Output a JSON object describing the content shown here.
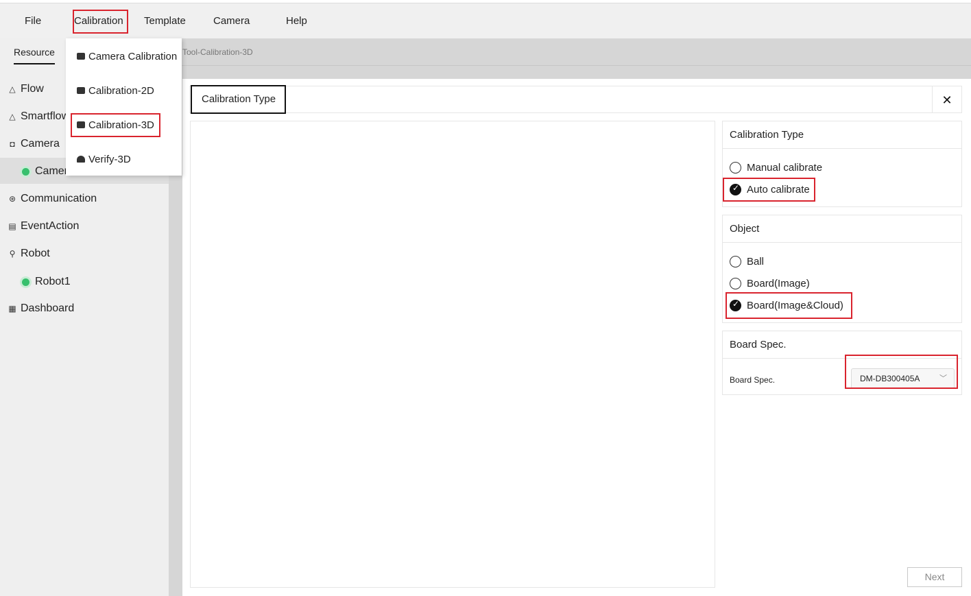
{
  "menubar": {
    "items": [
      "File",
      "Calibration",
      "Template",
      "Camera",
      "Help"
    ]
  },
  "calibration_menu": {
    "items": [
      "Camera Calibration",
      "Calibration-2D",
      "Calibration-3D",
      "Verify-3D"
    ]
  },
  "sidebar": {
    "tab": "Resource",
    "items": {
      "flow": "Flow",
      "smartflow": "Smartflow",
      "camera": "Camera",
      "camera_child": "Camera1",
      "communication": "Communication",
      "eventaction": "EventAction",
      "robot": "Robot",
      "robot_child": "Robot1",
      "dashboard": "Dashboard"
    }
  },
  "tabstrip": {
    "active_tab": "Tool-Calibration-3D"
  },
  "dialog": {
    "title": "Calibration Type",
    "close_glyph": "✕",
    "calibration_type": {
      "title": "Calibration Type",
      "options": [
        "Manual calibrate",
        "Auto calibrate"
      ],
      "selected": "Auto calibrate"
    },
    "object": {
      "title": "Object",
      "options": [
        "Ball",
        "Board(Image)",
        "Board(Image&Cloud)"
      ],
      "selected": "Board(Image&Cloud)"
    },
    "board_spec": {
      "title": "Board Spec.",
      "label": "Board Spec.",
      "value": "DM-DB300405A"
    },
    "next_label": "Next"
  },
  "colors": {
    "highlight": "#d9232d",
    "status_ok": "#37c06d",
    "panel_bg": "#efefef"
  },
  "icons": {
    "flow": "bell-outline-icon",
    "camera": "camera-icon",
    "communication": "network-icon",
    "eventaction": "document-icon",
    "robot": "robot-arm-icon",
    "dashboard": "dashboard-icon"
  }
}
